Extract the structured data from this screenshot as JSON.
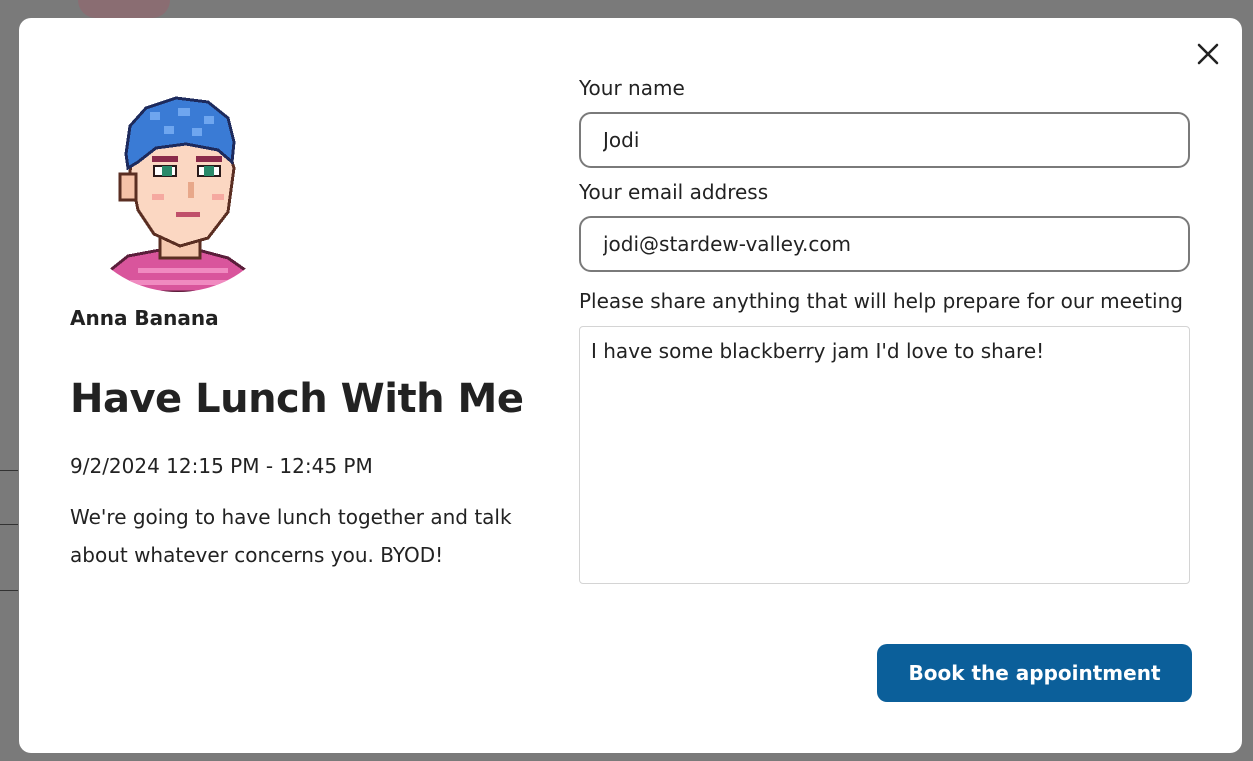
{
  "colors": {
    "overlay": "#6f6f6f",
    "modal_bg": "#ffffff",
    "primary_button": "#0b5f9a",
    "text": "#222222",
    "hair": "#3a7bd5",
    "shirt": "#d9559c"
  },
  "host": {
    "name": "Anna Banana",
    "avatar_icon": "pixel-art-portrait"
  },
  "event": {
    "title": "Have Lunch With Me",
    "time": "9/2/2024 12:15 PM - 12:45 PM",
    "description": "We're going to have lunch together and talk about whatever concerns you. BYOD!"
  },
  "form": {
    "name_label": "Your name",
    "name_value": "Jodi",
    "email_label": "Your email address",
    "email_value": "jodi@stardew-valley.com",
    "notes_label": "Please share anything that will help prepare for our meeting",
    "notes_value": "I have some blackberry jam I'd love to share!",
    "submit_label": "Book the appointment"
  },
  "close_icon": "close-icon"
}
